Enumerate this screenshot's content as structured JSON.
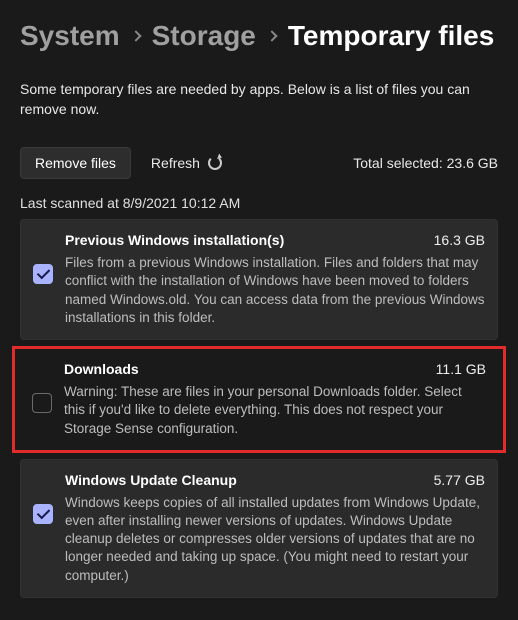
{
  "breadcrumb": {
    "system": "System",
    "storage": "Storage",
    "current": "Temporary files"
  },
  "intro": "Some temporary files are needed by apps. Below is a list of files you can remove now.",
  "actions": {
    "remove_label": "Remove files",
    "refresh_label": "Refresh",
    "total_label": "Total selected: 23.6 GB"
  },
  "last_scanned": "Last scanned at 8/9/2021 10:12 AM",
  "items": [
    {
      "title": "Previous Windows installation(s)",
      "size": "16.3 GB",
      "desc": "Files from a previous Windows installation.  Files and folders that may conflict with the installation of Windows have been moved to folders named Windows.old.  You can access data from the previous Windows installations in this folder.",
      "checked": true,
      "highlight": false
    },
    {
      "title": "Downloads",
      "size": "11.1 GB",
      "desc": "Warning: These are files in your personal Downloads folder. Select this if you'd like to delete everything. This does not respect your Storage Sense configuration.",
      "checked": false,
      "highlight": true
    },
    {
      "title": "Windows Update Cleanup",
      "size": "5.77 GB",
      "desc": "Windows keeps copies of all installed updates from Windows Update, even after installing newer versions of updates. Windows Update cleanup deletes or compresses older versions of updates that are no longer needed and taking up space. (You might need to restart your computer.)",
      "checked": true,
      "highlight": false
    }
  ]
}
